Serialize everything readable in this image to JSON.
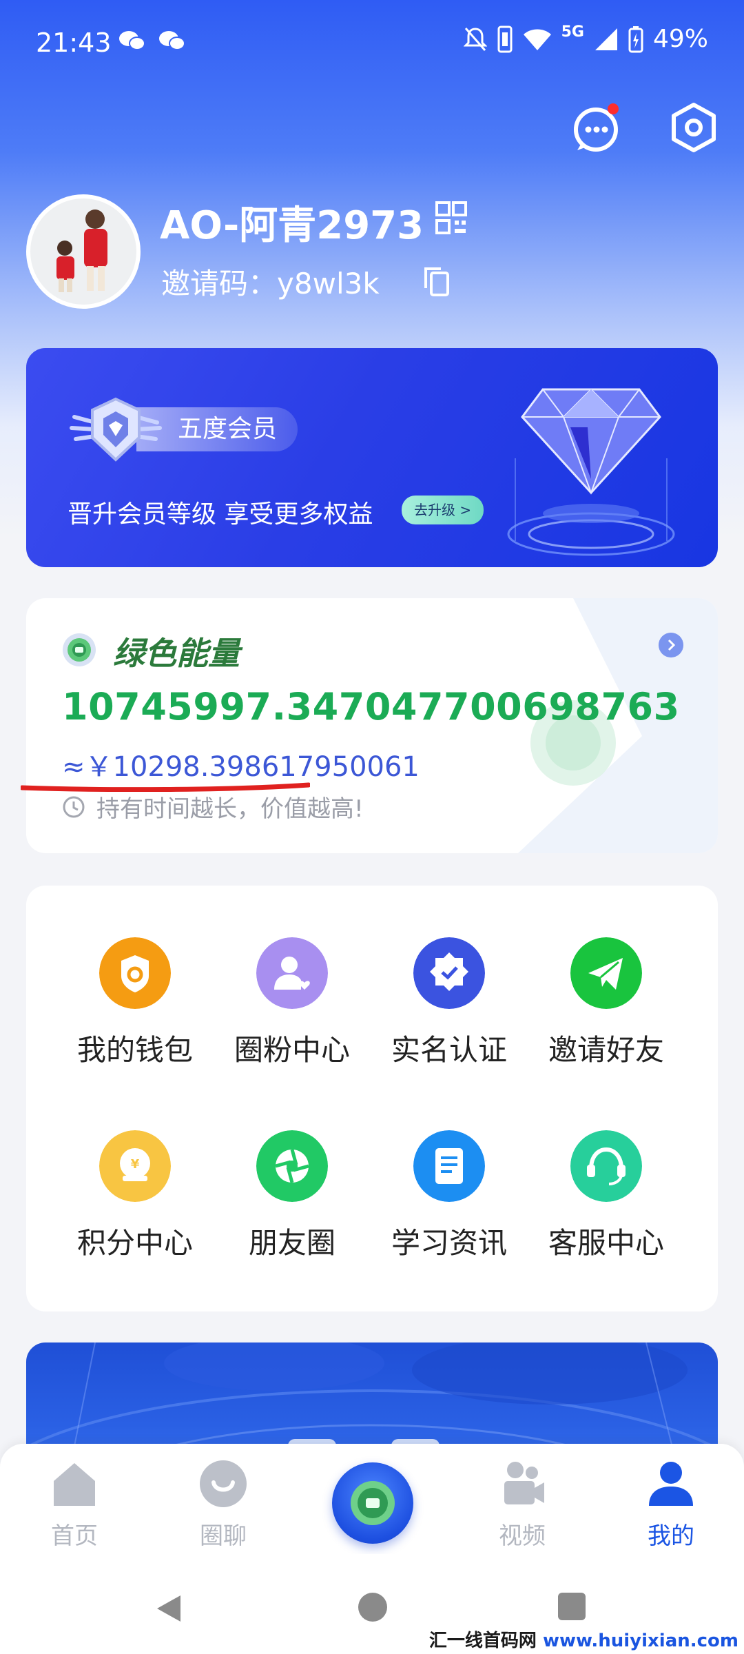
{
  "status_bar": {
    "time": "21:43",
    "network": "5G",
    "battery": "49%"
  },
  "profile": {
    "username": "AO-阿青2973",
    "invite_label": "邀请码：",
    "invite_code": "y8wl3k"
  },
  "vip": {
    "level": "五度会员",
    "description": "晋升会员等级  享受更多权益",
    "upgrade_label": "去升级",
    "upgrade_chevron": ">"
  },
  "energy": {
    "title": "绿色能量",
    "value": "10745997.347047700698763",
    "rmb_value": "≈￥10298.398617950061",
    "note": "持有时间越长，价值越高!"
  },
  "grid": {
    "items": [
      {
        "label": "我的钱包",
        "icon": "wallet-icon",
        "color": "#f59c12"
      },
      {
        "label": "圈粉中心",
        "icon": "fans-icon",
        "color": "#a88ff0"
      },
      {
        "label": "实名认证",
        "icon": "verify-icon",
        "color": "#3b53e0"
      },
      {
        "label": "邀请好友",
        "icon": "invite-icon",
        "color": "#19c43e"
      },
      {
        "label": "积分中心",
        "icon": "points-icon",
        "color": "#f8c542"
      },
      {
        "label": "朋友圈",
        "icon": "moments-icon",
        "color": "#21c965"
      },
      {
        "label": "学习资讯",
        "icon": "news-icon",
        "color": "#1c8ef2"
      },
      {
        "label": "客服中心",
        "icon": "service-icon",
        "color": "#27cf9b"
      }
    ]
  },
  "tabs": {
    "items": [
      {
        "label": "首页",
        "icon": "home-icon"
      },
      {
        "label": "圈聊",
        "icon": "chat-icon"
      },
      {
        "label": "视频",
        "icon": "video-icon"
      },
      {
        "label": "我的",
        "icon": "profile-icon"
      }
    ],
    "active": "我的"
  },
  "watermark": {
    "text_a": "汇一线首码网",
    "text_b": " www.huiyixian.com"
  },
  "colors": {
    "brand_blue": "#1b55e4",
    "energy_green": "#1bab55",
    "rmb_blue": "#3c57d6"
  }
}
